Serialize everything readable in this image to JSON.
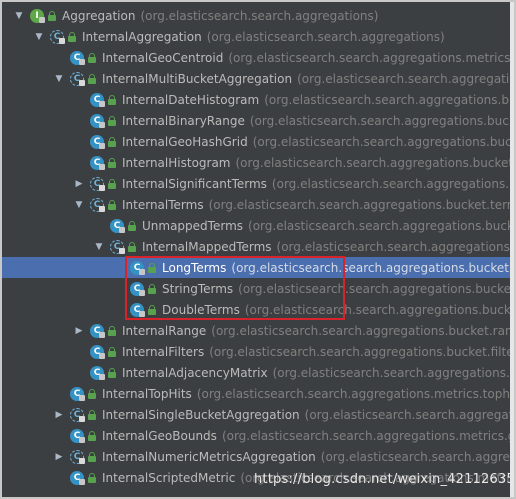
{
  "tree": {
    "rows": [
      {
        "name": "Aggregation",
        "pkg": "(org.elasticsearch.search.aggregations)",
        "arrow": "down",
        "kind": "interface",
        "badge": "I"
      },
      {
        "name": "InternalAggregation",
        "pkg": "(org.elasticsearch.search.aggregations)",
        "arrow": "down",
        "kind": "abstract",
        "badge": "C"
      },
      {
        "name": "InternalGeoCentroid",
        "pkg": "(org.elasticsearch.search.aggregations.metrics.geocentroid)",
        "arrow": "none",
        "kind": "class",
        "badge": "C"
      },
      {
        "name": "InternalMultiBucketAggregation",
        "pkg": "(org.elasticsearch.search.aggregations)",
        "arrow": "down",
        "kind": "abstract",
        "badge": "C"
      },
      {
        "name": "InternalDateHistogram",
        "pkg": "(org.elasticsearch.search.aggregations.bucket.histogram)",
        "arrow": "none",
        "kind": "class",
        "badge": "C"
      },
      {
        "name": "InternalBinaryRange",
        "pkg": "(org.elasticsearch.search.aggregations.bucket.range)",
        "arrow": "none",
        "kind": "class",
        "badge": "C"
      },
      {
        "name": "InternalGeoHashGrid",
        "pkg": "(org.elasticsearch.search.aggregations.bucket.geogrid)",
        "arrow": "none",
        "kind": "class",
        "badge": "C"
      },
      {
        "name": "InternalHistogram",
        "pkg": "(org.elasticsearch.search.aggregations.bucket.histogram)",
        "arrow": "none",
        "kind": "class",
        "badge": "C"
      },
      {
        "name": "InternalSignificantTerms",
        "pkg": "(org.elasticsearch.search.aggregations.bucket.significant)",
        "arrow": "right",
        "kind": "abstract",
        "badge": "C"
      },
      {
        "name": "InternalTerms",
        "pkg": "(org.elasticsearch.search.aggregations.bucket.terms)",
        "arrow": "down",
        "kind": "abstract",
        "badge": "C"
      },
      {
        "name": "UnmappedTerms",
        "pkg": "(org.elasticsearch.search.aggregations.bucket.terms)",
        "arrow": "none",
        "kind": "class",
        "badge": "C"
      },
      {
        "name": "InternalMappedTerms",
        "pkg": "(org.elasticsearch.search.aggregations.bucket.terms)",
        "arrow": "down",
        "kind": "abstract",
        "badge": "C"
      },
      {
        "name": "LongTerms",
        "pkg": "(org.elasticsearch.search.aggregations.bucket.terms)",
        "arrow": "none",
        "kind": "class",
        "badge": "C",
        "selected": true
      },
      {
        "name": "StringTerms",
        "pkg": "(org.elasticsearch.search.aggregations.bucket.terms)",
        "arrow": "none",
        "kind": "class",
        "badge": "C"
      },
      {
        "name": "DoubleTerms",
        "pkg": "(org.elasticsearch.search.aggregations.bucket.terms)",
        "arrow": "none",
        "kind": "class",
        "badge": "C"
      },
      {
        "name": "InternalRange",
        "pkg": "(org.elasticsearch.search.aggregations.bucket.range)",
        "arrow": "right",
        "kind": "class",
        "badge": "C"
      },
      {
        "name": "InternalFilters",
        "pkg": "(org.elasticsearch.search.aggregations.bucket.filters)",
        "arrow": "none",
        "kind": "class",
        "badge": "C"
      },
      {
        "name": "InternalAdjacencyMatrix",
        "pkg": "(org.elasticsearch.search.aggregations.bucket.adjacency)",
        "arrow": "none",
        "kind": "class",
        "badge": "C"
      },
      {
        "name": "InternalTopHits",
        "pkg": "(org.elasticsearch.search.aggregations.metrics.tophits)",
        "arrow": "none",
        "kind": "class",
        "badge": "C"
      },
      {
        "name": "InternalSingleBucketAggregation",
        "pkg": "(org.elasticsearch.search.aggregations.bucket)",
        "arrow": "right",
        "kind": "abstract",
        "badge": "C"
      },
      {
        "name": "InternalGeoBounds",
        "pkg": "(org.elasticsearch.search.aggregations.metrics.geobounds)",
        "arrow": "none",
        "kind": "class",
        "badge": "C"
      },
      {
        "name": "InternalNumericMetricsAggregation",
        "pkg": "(org.elasticsearch.search.aggregations.metrics)",
        "arrow": "right",
        "kind": "abstract",
        "badge": "C"
      },
      {
        "name": "InternalScriptedMetric",
        "pkg": "(org.elasticsearch.search.aggregations.metrics.scripted)",
        "arrow": "none",
        "kind": "class",
        "badge": "C"
      }
    ]
  },
  "watermark": "https://blog.csdn.net/weixin_42112635",
  "colors": {
    "background": "#3c3f41",
    "selection": "#4b6eaf",
    "class_icon": "#3592c4",
    "highlight_box": "#d9232a"
  }
}
